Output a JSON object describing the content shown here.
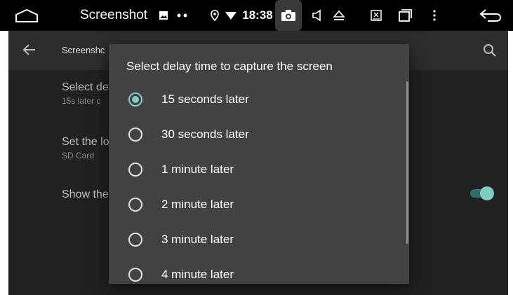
{
  "statusbar": {
    "app_name": "Screenshot",
    "time": "18:38",
    "icons": [
      "home-icon",
      "image-icon",
      "more-dots-icon",
      "location-icon",
      "wifi-icon",
      "camera-icon",
      "volume-icon",
      "eject-icon",
      "close-box-icon",
      "window-icon",
      "overflow-icon",
      "back-arrow-icon"
    ]
  },
  "toolbar": {
    "title": "Screenshc"
  },
  "preferences": [
    {
      "title": "Select de",
      "subtitle": "15s later c"
    },
    {
      "title": "Set the lo",
      "subtitle": "SD Card"
    },
    {
      "title": "Show the",
      "subtitle": ""
    }
  ],
  "dialog": {
    "title": "Select delay time to capture the screen",
    "options": [
      {
        "label": "15 seconds later",
        "selected": true
      },
      {
        "label": "30 seconds later",
        "selected": false
      },
      {
        "label": "1 minute later",
        "selected": false
      },
      {
        "label": "2 minute later",
        "selected": false
      },
      {
        "label": "3 minute later",
        "selected": false
      },
      {
        "label": "4 minute later",
        "selected": false
      }
    ]
  },
  "toggle": {
    "on": true
  },
  "colors": {
    "accent": "#80cbc4",
    "dialog": "#424242",
    "background": "#212121"
  }
}
